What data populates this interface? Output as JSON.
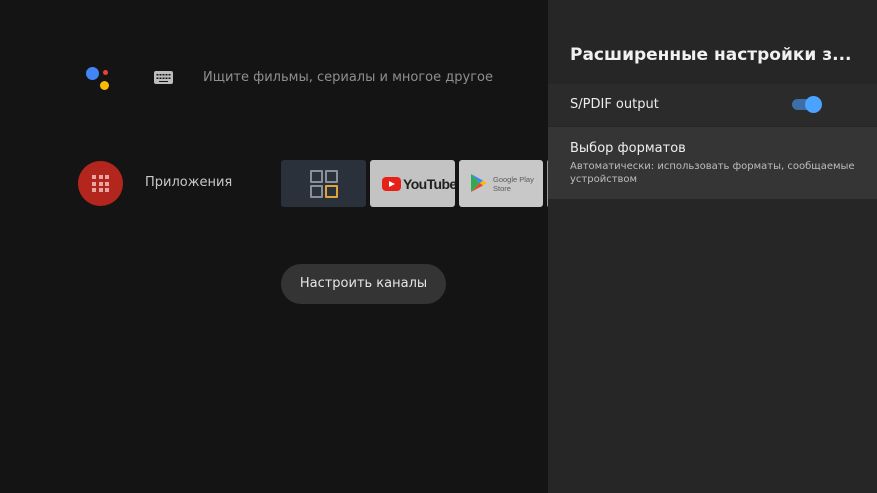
{
  "home": {
    "search": {
      "placeholder": "Ищите фильмы, сериалы и многое другое"
    },
    "apps_row": {
      "label": "Приложения",
      "tiles": [
        {
          "name": "apps-tile",
          "icon": "grid-squares-icon"
        },
        {
          "name": "youtube-tile",
          "logo_text": "YouTube"
        },
        {
          "name": "google-play-store-tile",
          "line1": "Google Play",
          "line2": "Store"
        }
      ]
    },
    "channels_button": {
      "label": "Настроить каналы"
    },
    "colors": {
      "apps_button": "#b3261e",
      "accent_blue": "#4285f4"
    }
  },
  "settings_panel": {
    "title": "Расширенные настройки з...",
    "items": [
      {
        "label": "S/PDIF output",
        "toggle_on": true
      },
      {
        "label": "Выбор форматов",
        "description": "Автоматически: использовать форматы, сообщаемые устройством"
      }
    ],
    "colors": {
      "toggle_thumb": "#4aa3ff",
      "toggle_track": "#3d6ea8"
    }
  }
}
